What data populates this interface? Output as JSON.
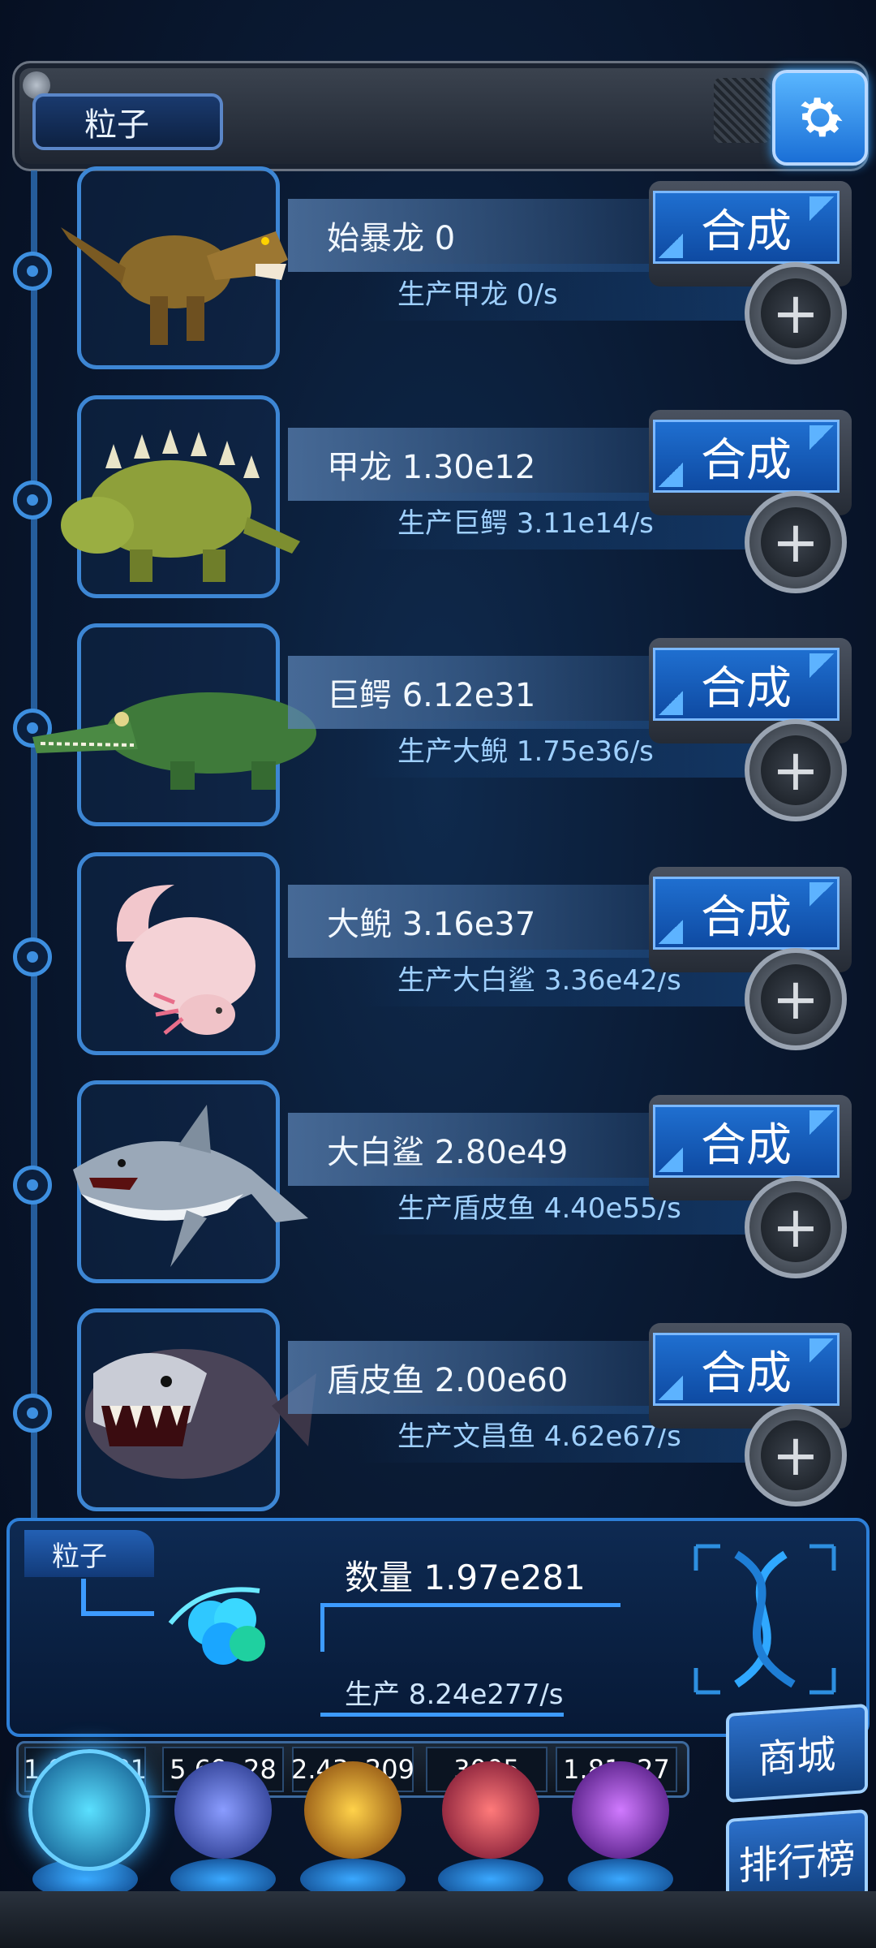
{
  "header": {
    "title": "粒子"
  },
  "rows": [
    {
      "name": "始暴龙 0",
      "production": "生产甲龙 0/s",
      "synth_label": "合成",
      "creature": "tyrannosaur"
    },
    {
      "name": "甲龙 1.30e12",
      "production": "生产巨鳄 3.11e14/s",
      "synth_label": "合成",
      "creature": "ankylosaur"
    },
    {
      "name": "巨鳄 6.12e31",
      "production": "生产大鲵 1.75e36/s",
      "synth_label": "合成",
      "creature": "crocodile"
    },
    {
      "name": "大鲵 3.16e37",
      "production": "生产大白鲨 3.36e42/s",
      "synth_label": "合成",
      "creature": "axolotl"
    },
    {
      "name": "大白鲨 2.80e49",
      "production": "生产盾皮鱼 4.40e55/s",
      "synth_label": "合成",
      "creature": "shark"
    },
    {
      "name": "盾皮鱼 2.00e60",
      "production": "生产文昌鱼 4.62e67/s",
      "synth_label": "合成",
      "creature": "dunkleosteus"
    }
  ],
  "resource": {
    "tag": "粒子",
    "quantity": "数量 1.97e281",
    "production": "生产 8.24e277/s"
  },
  "currencies": [
    {
      "value": "1.97e281",
      "orb": "particle-orb",
      "color": "#2fd0ff"
    },
    {
      "value": "5.69e28",
      "orb": "lightning-orb",
      "color": "#6a7cff"
    },
    {
      "value": "2.43e209",
      "orb": "fire-orb",
      "color": "#ffb02e"
    },
    {
      "value": "3005",
      "orb": "brain-orb",
      "color": "#ff4a6a"
    },
    {
      "value": "1.81e27",
      "orb": "vortex-orb",
      "color": "#b04aff"
    }
  ],
  "side_buttons": {
    "shop": "商城",
    "ranking": "排行榜"
  }
}
